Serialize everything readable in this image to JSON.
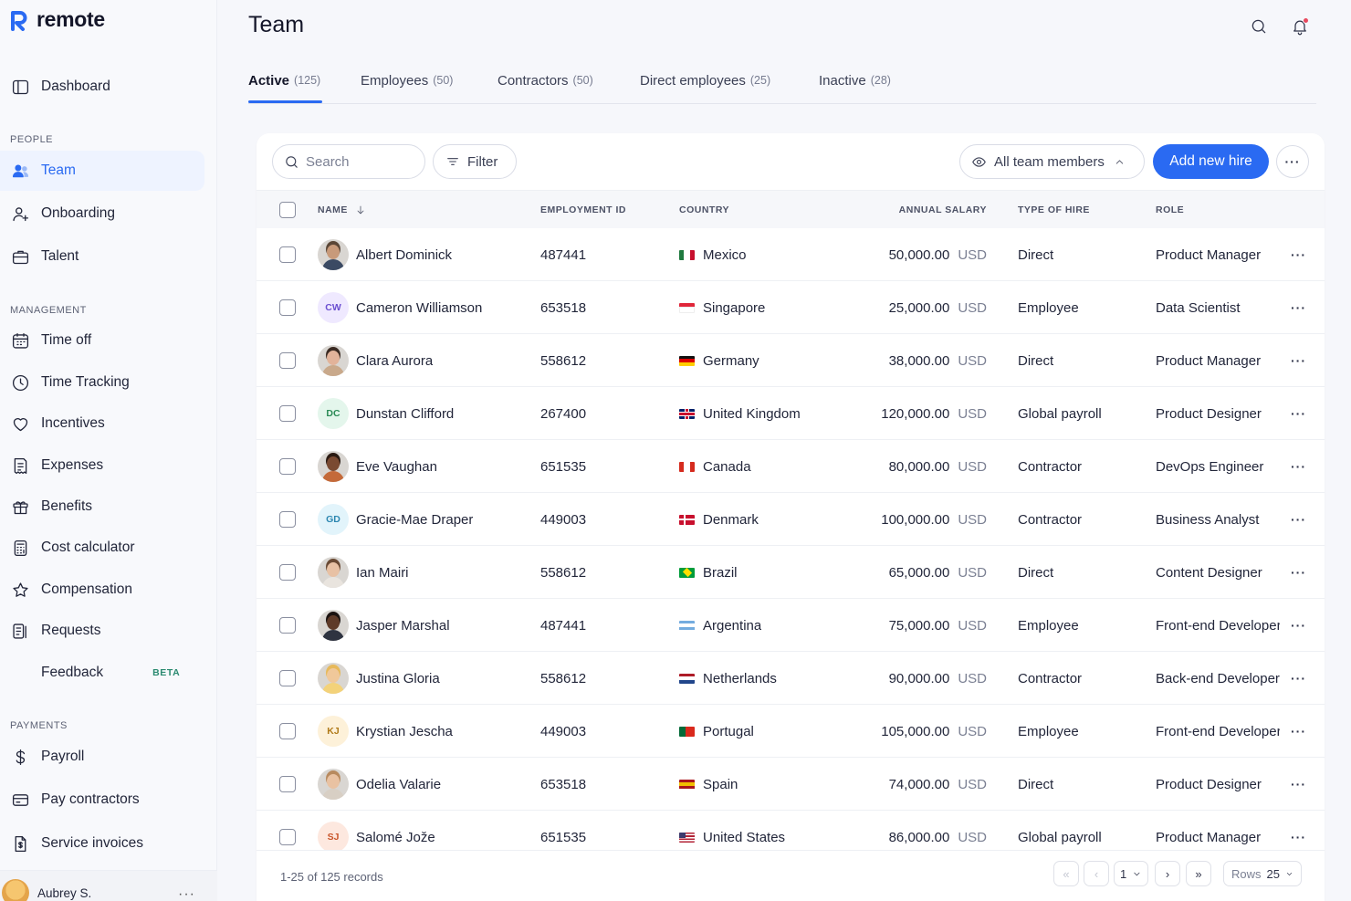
{
  "app": {
    "name": "remote",
    "brand_color": "#2a6af2"
  },
  "sidebar": {
    "dashboard": "Dashboard",
    "sections": {
      "people": "PEOPLE",
      "management": "MANAGEMENT",
      "payments": "PAYMENTS"
    },
    "people_items": [
      {
        "label": "Team",
        "icon": "team-icon",
        "active": true
      },
      {
        "label": "Onboarding",
        "icon": "onboarding-icon"
      },
      {
        "label": "Talent",
        "icon": "briefcase-icon"
      }
    ],
    "management_items": [
      {
        "label": "Time off",
        "icon": "calendar-icon"
      },
      {
        "label": "Time Tracking",
        "icon": "clock-icon"
      },
      {
        "label": "Incentives",
        "icon": "heart-icon"
      },
      {
        "label": "Expenses",
        "icon": "receipt-icon"
      },
      {
        "label": "Benefits",
        "icon": "gift-icon"
      },
      {
        "label": "Cost calculator",
        "icon": "calculator-icon"
      },
      {
        "label": "Compensation",
        "icon": "star-icon"
      },
      {
        "label": "Requests",
        "icon": "requests-icon"
      },
      {
        "label": "Feedback",
        "badge": "BETA"
      }
    ],
    "payments_items": [
      {
        "label": "Payroll",
        "icon": "dollar-icon"
      },
      {
        "label": "Pay contractors",
        "icon": "card-icon"
      },
      {
        "label": "Service invoices",
        "icon": "invoice-icon"
      }
    ],
    "user": {
      "name": "Aubrey S."
    }
  },
  "header": {
    "title": "Team"
  },
  "tabs": [
    {
      "label": "Active",
      "count": "(125)",
      "active": true
    },
    {
      "label": "Employees",
      "count": "(50)"
    },
    {
      "label": "Contractors",
      "count": "(50)"
    },
    {
      "label": "Direct employees",
      "count": "(25)"
    },
    {
      "label": "Inactive",
      "count": "(28)"
    }
  ],
  "toolbar": {
    "search_placeholder": "Search",
    "filter_label": "Filter",
    "view_label": "All team members",
    "add_label": "Add new hire"
  },
  "table": {
    "columns": {
      "name": "NAME",
      "employment_id": "EMPLOYMENT ID",
      "country": "COUNTRY",
      "salary": "ANNUAL SALARY",
      "type": "TYPE OF HIRE",
      "role": "ROLE"
    },
    "rows": [
      {
        "name": "Albert Dominick",
        "avatar": "photo",
        "skin": "#c89a7a",
        "hair": "#5a4636",
        "shirt": "#3b4a63",
        "id": "487441",
        "country": "Mexico",
        "flag": [
          "#1f7a3f",
          "#ffffff",
          "#c8102e"
        ],
        "salary": "50,000.00",
        "currency": "USD",
        "type": "Direct",
        "role": "Product Manager"
      },
      {
        "name": "Cameron Williamson",
        "avatar": "initials",
        "initials": "CW",
        "av_bg": "#efe9ff",
        "av_fg": "#6b4fd1",
        "id": "653518",
        "country": "Singapore",
        "flag": [
          "#e0263a",
          "#ffffff"
        ],
        "salary": "25,000.00",
        "currency": "USD",
        "type": "Employee",
        "role": "Data Scientist"
      },
      {
        "name": "Clara Aurora",
        "avatar": "photo",
        "skin": "#e2b39a",
        "hair": "#3a2a22",
        "shirt": "#c9a98b",
        "id": "558612",
        "country": "Germany",
        "flag": [
          "#111111",
          "#dd0000",
          "#ffce00"
        ],
        "salary": "38,000.00",
        "currency": "USD",
        "type": "Direct",
        "role": "Product Manager"
      },
      {
        "name": "Dunstan Clifford",
        "avatar": "initials",
        "initials": "DC",
        "av_bg": "#e4f6ec",
        "av_fg": "#2a8a55",
        "id": "267400",
        "country": "United Kingdom",
        "flag": [
          "#012169",
          "#ffffff",
          "#c8102e"
        ],
        "salary": "120,000.00",
        "currency": "USD",
        "type": "Global payroll",
        "role": "Product Designer"
      },
      {
        "name": "Eve Vaughan",
        "avatar": "photo",
        "skin": "#7a4a32",
        "hair": "#2a1a12",
        "shirt": "#c46a3a",
        "id": "651535",
        "country": "Canada",
        "flag": [
          "#d52b1e",
          "#ffffff",
          "#d52b1e"
        ],
        "salary": "80,000.00",
        "currency": "USD",
        "type": "Contractor",
        "role": "DevOps Engineer"
      },
      {
        "name": "Gracie-Mae Draper",
        "avatar": "initials",
        "initials": "GD",
        "av_bg": "#e2f4fb",
        "av_fg": "#2b86b0",
        "id": "449003",
        "country": "Denmark",
        "flag": [
          "#c8102e",
          "#ffffff",
          "#c8102e"
        ],
        "salary": "100,000.00",
        "currency": "USD",
        "type": "Contractor",
        "role": "Business Analyst"
      },
      {
        "name": "Ian Mairi",
        "avatar": "photo",
        "skin": "#e8c1a4",
        "hair": "#6a4a34",
        "shirt": "#e9e4de",
        "id": "558612",
        "country": "Brazil",
        "flag": [
          "#009c3b",
          "#ffdf00",
          "#009c3b"
        ],
        "salary": "65,000.00",
        "currency": "USD",
        "type": "Direct",
        "role": "Content Designer"
      },
      {
        "name": "Jasper Marshal",
        "avatar": "photo",
        "skin": "#5e3a28",
        "hair": "#1a1210",
        "shirt": "#2e3340",
        "id": "487441",
        "country": "Argentina",
        "flag": [
          "#74acdf",
          "#ffffff",
          "#74acdf"
        ],
        "salary": "75,000.00",
        "currency": "USD",
        "type": "Employee",
        "role": "Front-end Developer"
      },
      {
        "name": "Justina Gloria",
        "avatar": "photo",
        "skin": "#f0c89a",
        "hair": "#e7b95a",
        "shirt": "#f3d27a",
        "id": "558612",
        "country": "Netherlands",
        "flag": [
          "#ae1c28",
          "#ffffff",
          "#21468b"
        ],
        "salary": "90,000.00",
        "currency": "USD",
        "type": "Contractor",
        "role": "Back-end Developer"
      },
      {
        "name": "Krystian Jescha",
        "avatar": "initials",
        "initials": "KJ",
        "av_bg": "#fdf1d9",
        "av_fg": "#b07a18",
        "id": "449003",
        "country": "Portugal",
        "flag": [
          "#046a38",
          "#da291c",
          "#da291c"
        ],
        "salary": "105,000.00",
        "currency": "USD",
        "type": "Employee",
        "role": "Front-end Developer"
      },
      {
        "name": "Odelia Valarie",
        "avatar": "photo",
        "skin": "#e9c2a2",
        "hair": "#b88a5e",
        "shirt": "#d8cfc4",
        "id": "653518",
        "country": "Spain",
        "flag": [
          "#aa151b",
          "#f1bf00",
          "#aa151b"
        ],
        "salary": "74,000.00",
        "currency": "USD",
        "type": "Direct",
        "role": "Product Designer"
      },
      {
        "name": "Salomé Jože",
        "avatar": "initials",
        "initials": "SJ",
        "av_bg": "#fde8df",
        "av_fg": "#c9562b",
        "id": "651535",
        "country": "United States",
        "flag": [
          "#b22234",
          "#ffffff",
          "#3c3b6e"
        ],
        "salary": "86,000.00",
        "currency": "USD",
        "type": "Global payroll",
        "role": "Product Manager"
      }
    ]
  },
  "pagination": {
    "records": "1-25 of 125 records",
    "page": "1",
    "rows_label": "Rows",
    "rows_value": "25"
  }
}
